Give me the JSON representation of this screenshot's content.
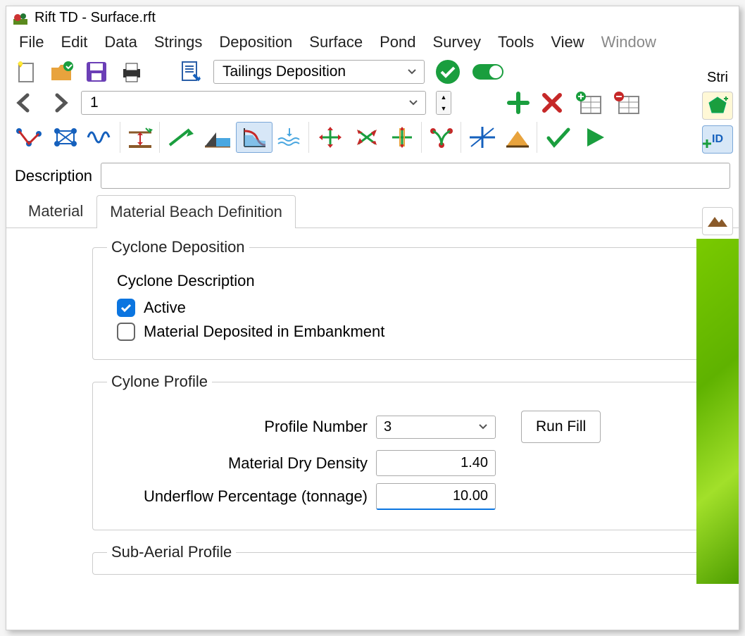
{
  "title": "Rift TD - Surface.rft",
  "menu": [
    "File",
    "Edit",
    "Data",
    "Strings",
    "Deposition",
    "Surface",
    "Pond",
    "Survey",
    "Tools",
    "View",
    "Window"
  ],
  "toolbar": {
    "select_value": "Tailings Deposition",
    "nav_value": "1"
  },
  "description_label": "Description",
  "description_value": "",
  "tabs": {
    "material": "Material",
    "beach": "Material Beach Definition"
  },
  "cyclone_deposition": {
    "legend": "Cyclone Deposition",
    "desc_label": "Cyclone Description",
    "active_label": "Active",
    "active_checked": true,
    "embank_label": "Material Deposited in Embankment",
    "embank_checked": false
  },
  "cyclone_profile": {
    "legend": "Cylone Profile",
    "profile_number_label": "Profile Number",
    "profile_number_value": "3",
    "run_fill": "Run Fill",
    "dry_density_label": "Material Dry Density",
    "dry_density_value": "1.40",
    "underflow_label": "Underflow Percentage (tonnage)",
    "underflow_value": "10.00"
  },
  "sub_aerial": {
    "legend": "Sub-Aerial Profile"
  },
  "right": {
    "stri": "Stri",
    "id": "ID"
  }
}
